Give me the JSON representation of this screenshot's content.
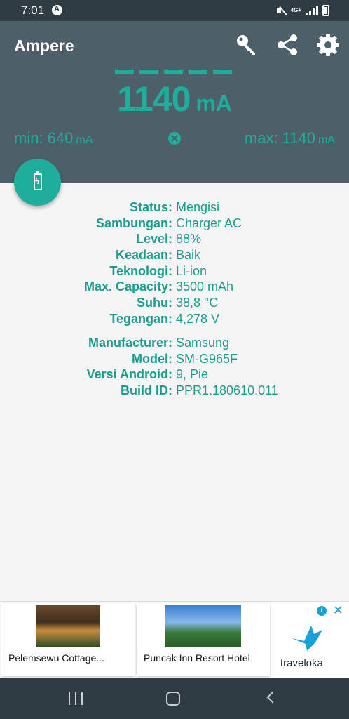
{
  "status_bar": {
    "time": "7:01",
    "network": "4G+"
  },
  "app": {
    "title": "Ampere"
  },
  "current": {
    "value": "1140",
    "unit": "mA",
    "min_label": "min: 640",
    "max_label": "max: 1140",
    "min_unit": "mA",
    "max_unit": "mA"
  },
  "info": [
    {
      "label": "Status:",
      "value": "Mengisi"
    },
    {
      "label": "Sambungan:",
      "value": "Charger AC"
    },
    {
      "label": "Level:",
      "value": "88%"
    },
    {
      "label": "Keadaan:",
      "value": "Baik"
    },
    {
      "label": "Teknologi:",
      "value": "Li-ion"
    },
    {
      "label": "Max. Capacity:",
      "value": "3500 mAh"
    },
    {
      "label": "Suhu:",
      "value": "38,8 °C"
    },
    {
      "label": "Tegangan:",
      "value": "4,278 V"
    }
  ],
  "device": [
    {
      "label": "Manufacturer:",
      "value": "Samsung"
    },
    {
      "label": "Model:",
      "value": "SM-G965F"
    },
    {
      "label": "Versi Android:",
      "value": "9, Pie"
    },
    {
      "label": "Build ID:",
      "value": "PPR1.180610.011"
    }
  ],
  "ad": {
    "cards": [
      {
        "caption": "Pelemsewu Cottage..."
      },
      {
        "caption": "Puncak Inn Resort Hotel"
      }
    ],
    "brand": "traveloka"
  },
  "colors": {
    "accent": "#1fae9b",
    "header_bg": "#4d5f69",
    "status_bg": "#2f3c43"
  }
}
